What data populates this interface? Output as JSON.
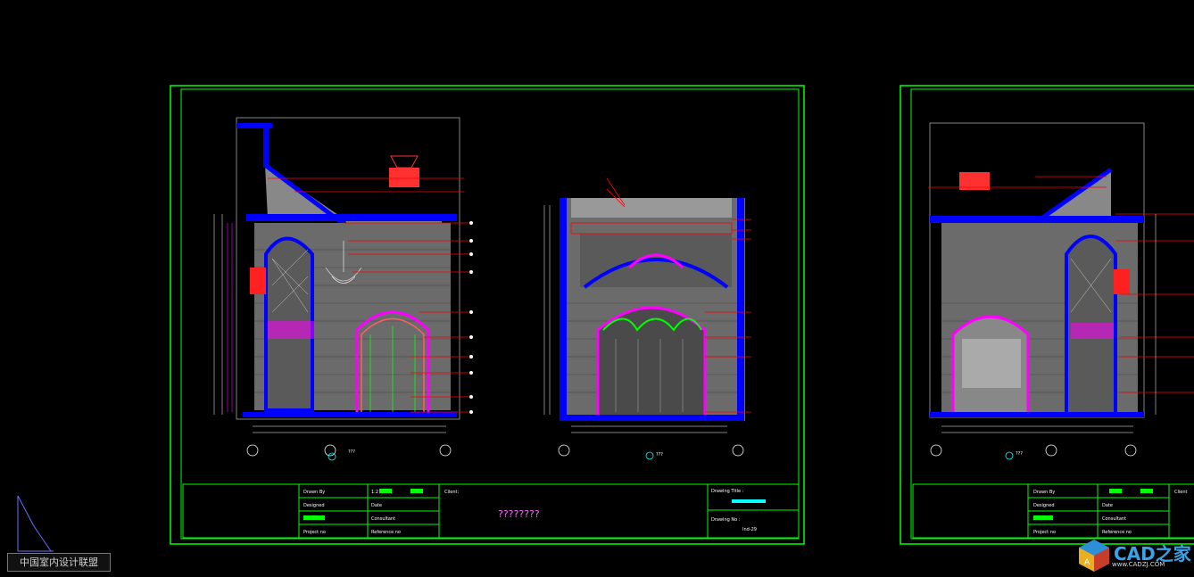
{
  "watermark": "中国室内设计联盟",
  "logo": {
    "name": "CAD之家",
    "url": "www.CADZJ.COM"
  },
  "sheet_a": {
    "title_block": {
      "drawn_by": "Drawn By",
      "designed": "Designed",
      "project_no": "Project no",
      "scale_a": "1:2",
      "date": "Date",
      "consultant": "Consultant",
      "reference_no": "Reference no",
      "client": "Client:",
      "project_name": "????????",
      "drawing_title": "Drawing Title :",
      "drawing_no": "Drawing No :",
      "sheet_code": "Ind-29"
    },
    "view_labels": [
      "???",
      "???"
    ]
  },
  "sheet_b": {
    "title_block": {
      "drawn_by": "Drawn By",
      "designed": "Designed",
      "project_no": "Project no",
      "date": "Date",
      "consultant": "Consultant",
      "reference_no": "Reference no",
      "client": "Client"
    },
    "view_labels": [
      "???"
    ]
  },
  "colors": {
    "background": "#000000",
    "frame": "#00ff00",
    "wall": "#0000ff",
    "leader": "#ff0000",
    "detail": "#ff00ff"
  }
}
